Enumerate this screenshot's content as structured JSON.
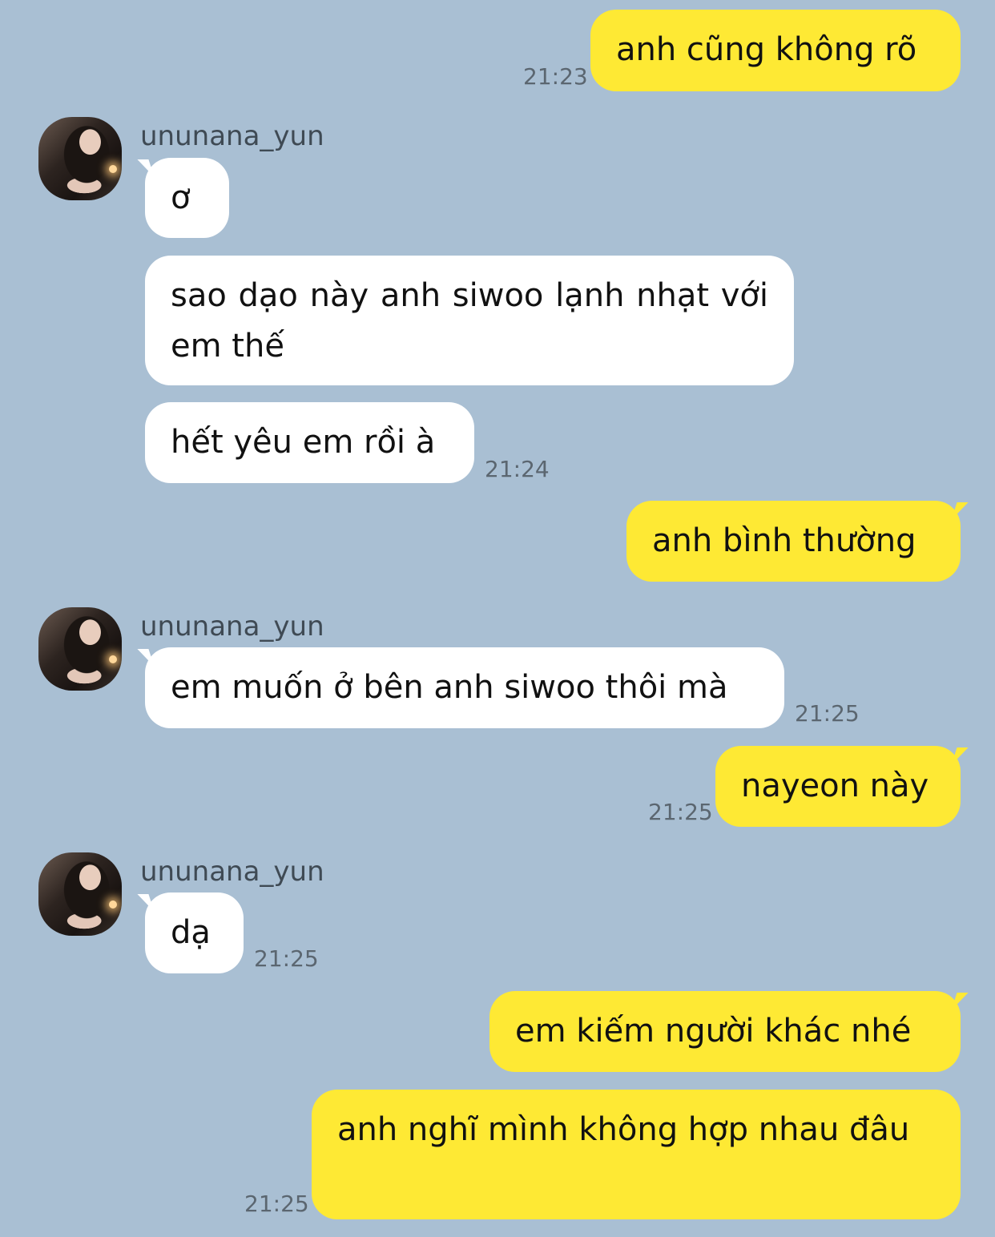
{
  "contact": {
    "name": "ununana_yun",
    "avatar_icon": "profile-photo"
  },
  "colors": {
    "background": "#a9bfd3",
    "me_bubble": "#fee934",
    "them_bubble": "#ffffff"
  },
  "messages": [
    {
      "from": "me",
      "text": "anh cũng không rõ",
      "time": "21:23"
    },
    {
      "from": "them",
      "text": "ơ",
      "time": ""
    },
    {
      "from": "them",
      "text": "sao dạo này anh siwoo lạnh nhạt với em thế",
      "time": ""
    },
    {
      "from": "them",
      "text": "hết yêu em rồi à",
      "time": "21:24"
    },
    {
      "from": "me",
      "text": "anh bình thường",
      "time": ""
    },
    {
      "from": "them",
      "text": "em muốn ở bên anh siwoo thôi mà",
      "time": "21:25"
    },
    {
      "from": "me",
      "text": "nayeon này",
      "time": "21:25"
    },
    {
      "from": "them",
      "text": "dạ",
      "time": "21:25"
    },
    {
      "from": "me",
      "text": "em kiếm người khác nhé",
      "time": ""
    },
    {
      "from": "me",
      "text": "anh nghĩ mình không hợp nhau đâu",
      "time": "21:25"
    }
  ]
}
